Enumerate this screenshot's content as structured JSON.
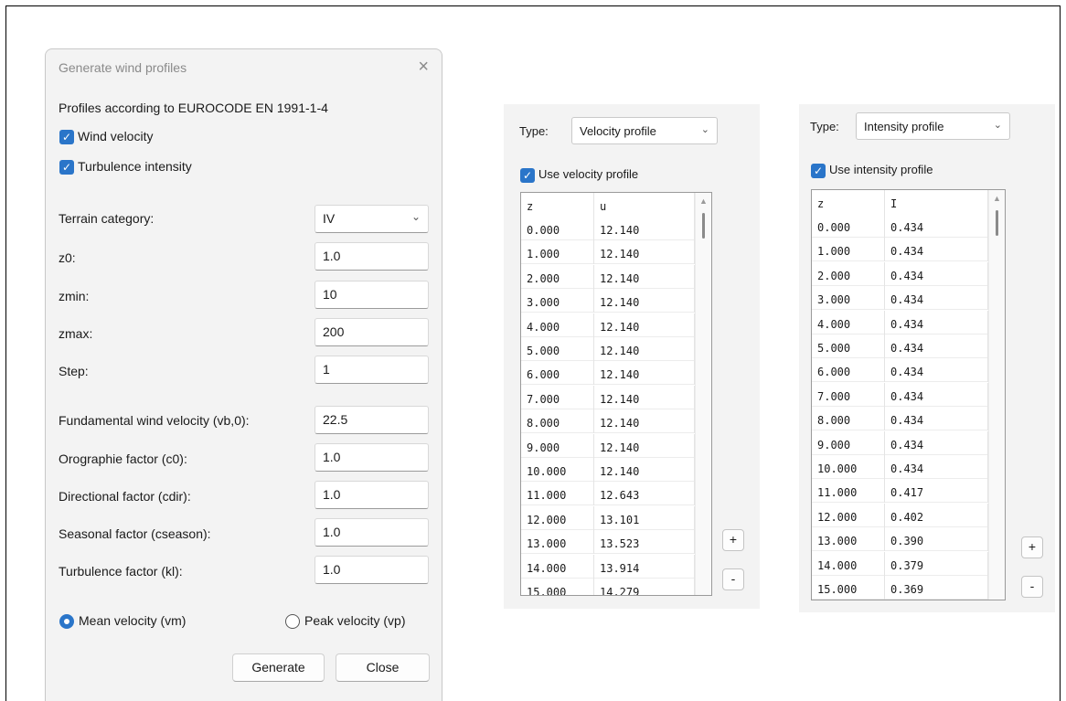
{
  "dialog": {
    "title": "Generate wind profiles",
    "heading": "Profiles according to EUROCODE EN 1991-1-4",
    "wind_velocity_label": "Wind velocity",
    "turbulence_intensity_label": "Turbulence intensity",
    "terrain_label": "Terrain category:",
    "terrain_value": "IV",
    "z0_label": "z0:",
    "z0_value": "1.0",
    "zmin_label": "zmin:",
    "zmin_value": "10",
    "zmax_label": "zmax:",
    "zmax_value": "200",
    "step_label": "Step:",
    "step_value": "1",
    "vb0_label": "Fundamental wind velocity (vb,0):",
    "vb0_value": "22.5",
    "c0_label": "Orographie factor (c0):",
    "c0_value": "1.0",
    "cdir_label": "Directional factor (cdir):",
    "cdir_value": "1.0",
    "cseason_label": "Seasonal factor (cseason):",
    "cseason_value": "1.0",
    "kl_label": "Turbulence factor (kl):",
    "kl_value": "1.0",
    "mean_velocity_label": "Mean  velocity (vm)",
    "peak_velocity_label": "Peak velocity (vp)",
    "generate_label": "Generate",
    "close_label": "Close",
    "close_icon": "×"
  },
  "velocity_panel": {
    "type_label": "Type:",
    "type_value": "Velocity profile",
    "use_label": "Use velocity profile",
    "col_z": "z",
    "col_v": "u",
    "rows": [
      [
        "0.000",
        "12.140"
      ],
      [
        "1.000",
        "12.140"
      ],
      [
        "2.000",
        "12.140"
      ],
      [
        "3.000",
        "12.140"
      ],
      [
        "4.000",
        "12.140"
      ],
      [
        "5.000",
        "12.140"
      ],
      [
        "6.000",
        "12.140"
      ],
      [
        "7.000",
        "12.140"
      ],
      [
        "8.000",
        "12.140"
      ],
      [
        "9.000",
        "12.140"
      ],
      [
        "10.000",
        "12.140"
      ],
      [
        "11.000",
        "12.643"
      ],
      [
        "12.000",
        "13.101"
      ],
      [
        "13.000",
        "13.523"
      ],
      [
        "14.000",
        "13.914"
      ],
      [
        "15.000",
        "14.279"
      ]
    ],
    "add_label": "+",
    "remove_label": "-"
  },
  "intensity_panel": {
    "type_label": "Type:",
    "type_value": "Intensity profile",
    "use_label": "Use intensity profile",
    "col_z": "z",
    "col_v": "I",
    "rows": [
      [
        "0.000",
        "0.434"
      ],
      [
        "1.000",
        "0.434"
      ],
      [
        "2.000",
        "0.434"
      ],
      [
        "3.000",
        "0.434"
      ],
      [
        "4.000",
        "0.434"
      ],
      [
        "5.000",
        "0.434"
      ],
      [
        "6.000",
        "0.434"
      ],
      [
        "7.000",
        "0.434"
      ],
      [
        "8.000",
        "0.434"
      ],
      [
        "9.000",
        "0.434"
      ],
      [
        "10.000",
        "0.434"
      ],
      [
        "11.000",
        "0.417"
      ],
      [
        "12.000",
        "0.402"
      ],
      [
        "13.000",
        "0.390"
      ],
      [
        "14.000",
        "0.379"
      ],
      [
        "15.000",
        "0.369"
      ]
    ],
    "add_label": "+",
    "remove_label": "-"
  },
  "colors": {
    "accent": "#2a75c9",
    "dialog_bg": "#f3f3f3"
  }
}
